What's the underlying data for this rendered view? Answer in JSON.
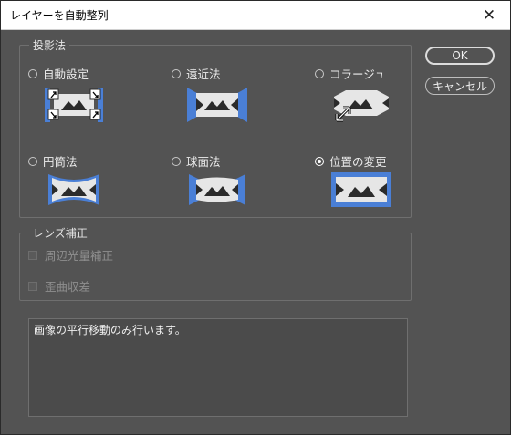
{
  "window": {
    "title": "レイヤーを自動整列",
    "close_glyph": "✕"
  },
  "projection": {
    "group_label": "投影法",
    "options": [
      {
        "label": "自動設定",
        "icon": "auto-projection-icon",
        "selected": false
      },
      {
        "label": "遠近法",
        "icon": "perspective-projection-icon",
        "selected": false
      },
      {
        "label": "コラージュ",
        "icon": "collage-projection-icon",
        "selected": false
      },
      {
        "label": "円筒法",
        "icon": "cylindrical-projection-icon",
        "selected": false
      },
      {
        "label": "球面法",
        "icon": "spherical-projection-icon",
        "selected": false
      },
      {
        "label": "位置の変更",
        "icon": "reposition-projection-icon",
        "selected": true
      }
    ]
  },
  "lens": {
    "group_label": "レンズ補正",
    "options": [
      {
        "label": "周辺光量補正",
        "checked": false,
        "enabled": false
      },
      {
        "label": "歪曲収差",
        "checked": false,
        "enabled": false
      }
    ]
  },
  "description": "画像の平行移動のみ行います。",
  "buttons": {
    "ok": "OK",
    "cancel": "キャンセル"
  },
  "colors": {
    "accent": "#4a7fd6",
    "panel": "#535353",
    "image_fill": "#e6e6e6"
  }
}
